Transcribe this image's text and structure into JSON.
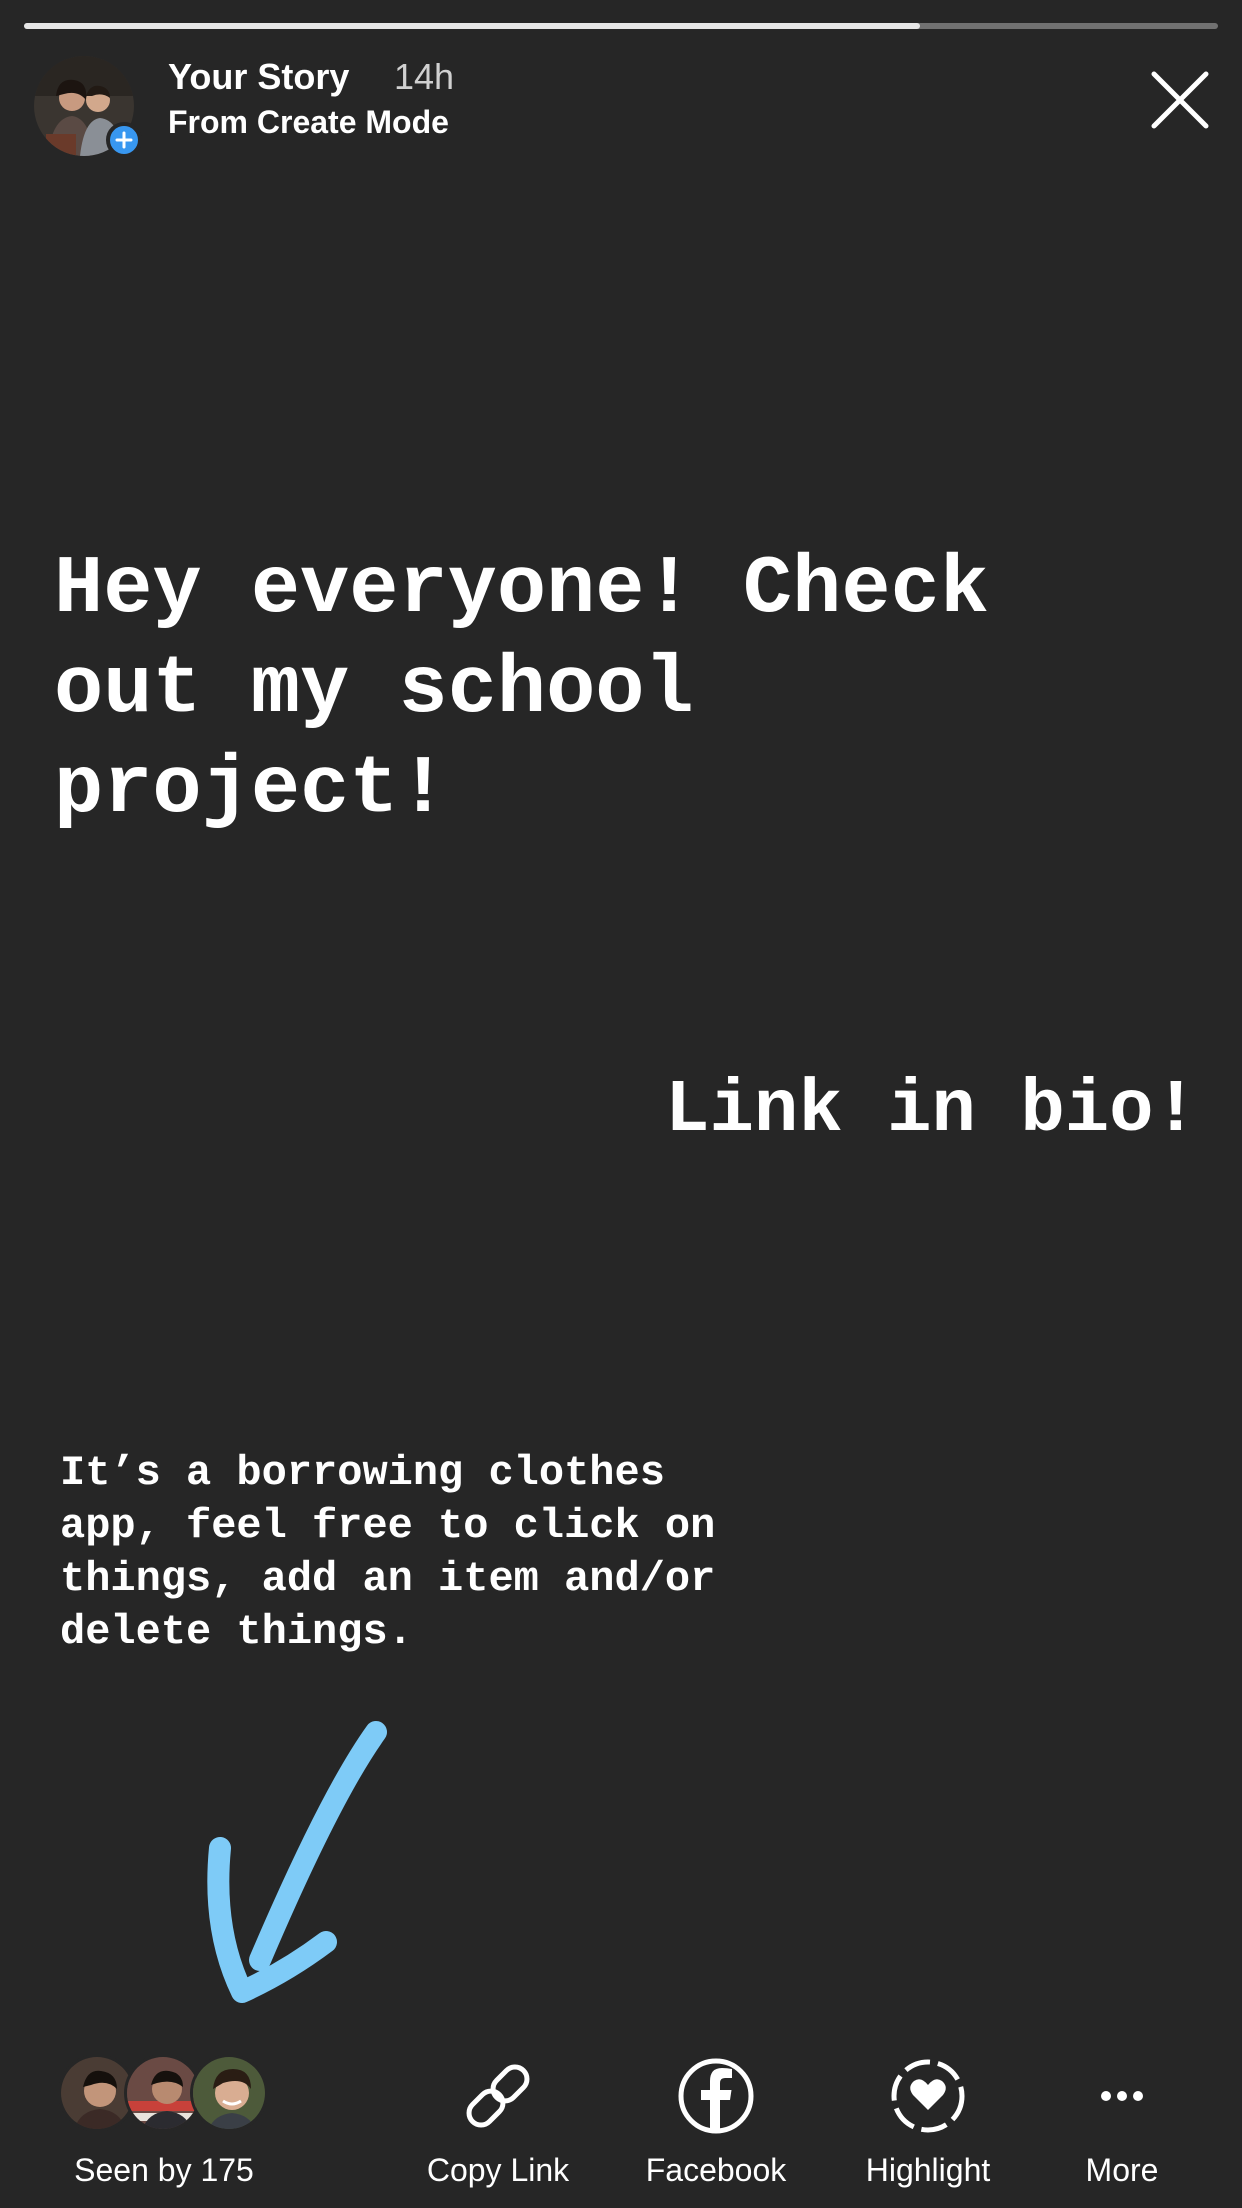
{
  "progress": {
    "fraction": 0.75,
    "fill_color": "#e6e6e6"
  },
  "header": {
    "title": "Your Story",
    "time": "14h",
    "subtitle": "From Create Mode",
    "avatar_icon": "profile-photo",
    "add_icon": "plus-icon",
    "close_icon": "close-icon"
  },
  "story": {
    "headline": "Hey everyone! Check\nout my school\nproject!",
    "link_text": "Link in bio!",
    "description": "It’s a borrowing clothes\napp, feel free to click on\nthings, add an item and/or\ndelete things.",
    "arrow_color": "#7ecbf7",
    "background_color": "#262626"
  },
  "footer": {
    "seen_by": "Seen by 175",
    "viewers": [
      "viewer-1",
      "viewer-2",
      "viewer-3"
    ],
    "actions": [
      {
        "label": "Copy Link",
        "icon": "link-icon"
      },
      {
        "label": "Facebook",
        "icon": "facebook-icon"
      },
      {
        "label": "Highlight",
        "icon": "highlight-heart-icon"
      },
      {
        "label": "More",
        "icon": "more-dots-icon"
      }
    ]
  },
  "colors": {
    "accent": "#3897f0",
    "text": "#ffffff"
  }
}
